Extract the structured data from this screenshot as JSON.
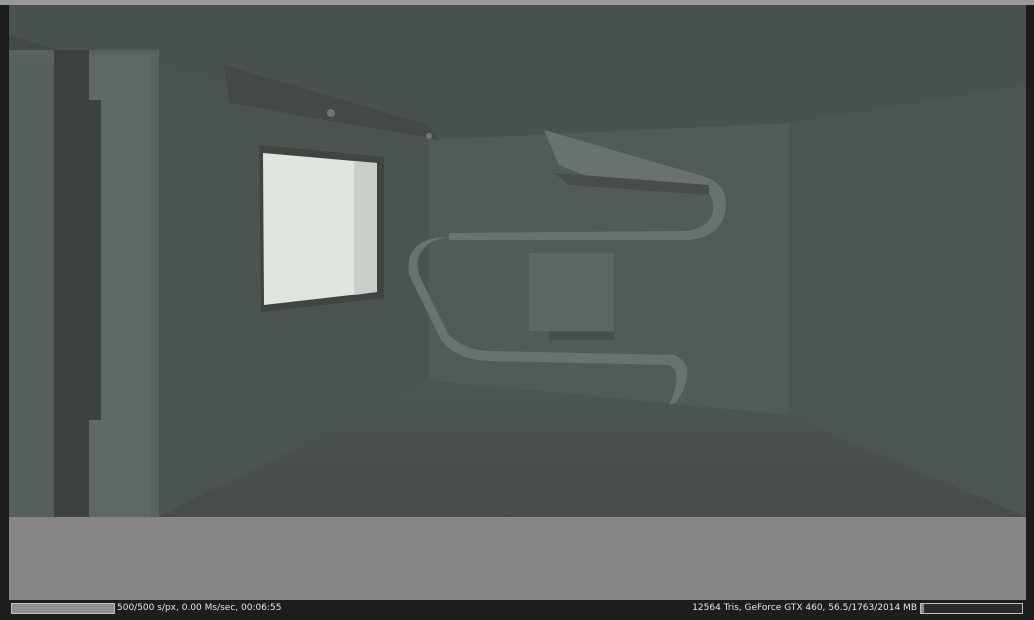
{
  "status_bar": {
    "render_stats": "500/500 s/px, 0.00 Ms/sec, 00:06:55",
    "scene_stats": "12564 Tris, GeForce GTX 460, 56.5/1763/2014 MB",
    "samples_progress": 1.0,
    "memory_progress": 0.03
  },
  "colors": {
    "render_tint": "#525a55",
    "viewport_background": "#858585",
    "status_bar_background": "#1d1d1d"
  },
  "render_view": {
    "content": "grayscale clay render of interior room with window and curved wall shelf"
  }
}
